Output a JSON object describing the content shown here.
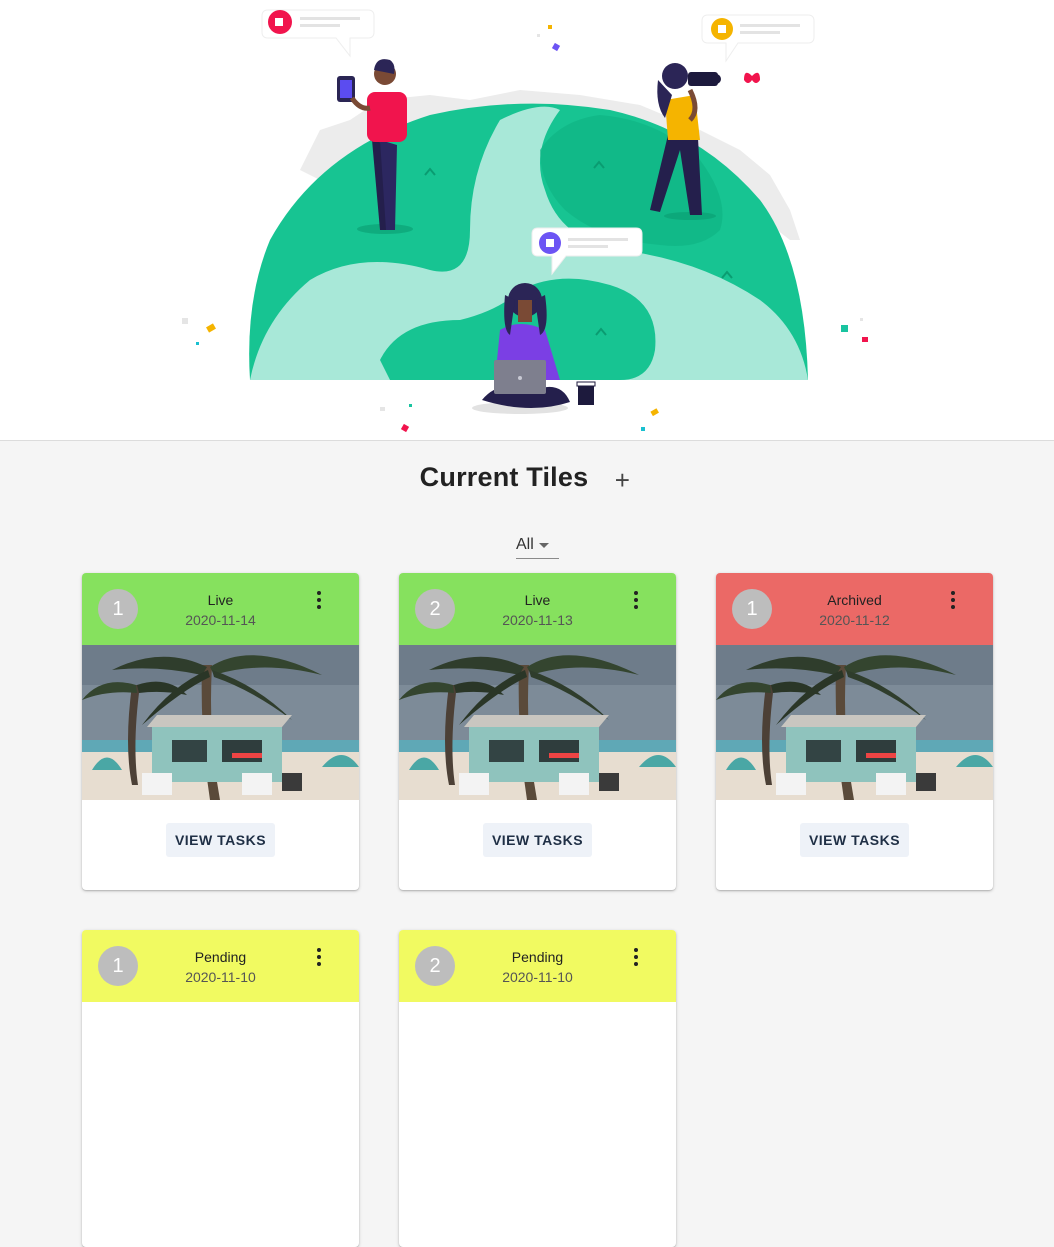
{
  "header": {
    "title": "Current Tiles",
    "add_symbol": "+"
  },
  "filter": {
    "selected": "All"
  },
  "card_template": {
    "action_label": "VIEW TASKS"
  },
  "cards": [
    {
      "number": "1",
      "status": "Live",
      "date": "2020-11-14",
      "color": "#86e15e"
    },
    {
      "number": "2",
      "status": "Live",
      "date": "2020-11-13",
      "color": "#86e15e"
    },
    {
      "number": "1",
      "status": "Archived",
      "date": "2020-11-12",
      "color": "#eb6966"
    },
    {
      "number": "1",
      "status": "Pending",
      "date": "2020-11-10",
      "color": "#f1fa61"
    },
    {
      "number": "2",
      "status": "Pending",
      "date": "2020-11-10",
      "color": "#f1fa61"
    }
  ],
  "colors": {
    "live": "#86e15e",
    "archived": "#eb6966",
    "pending": "#f1fa61",
    "globe_green": "#19c79a",
    "avatar": "#bdbdbd"
  }
}
